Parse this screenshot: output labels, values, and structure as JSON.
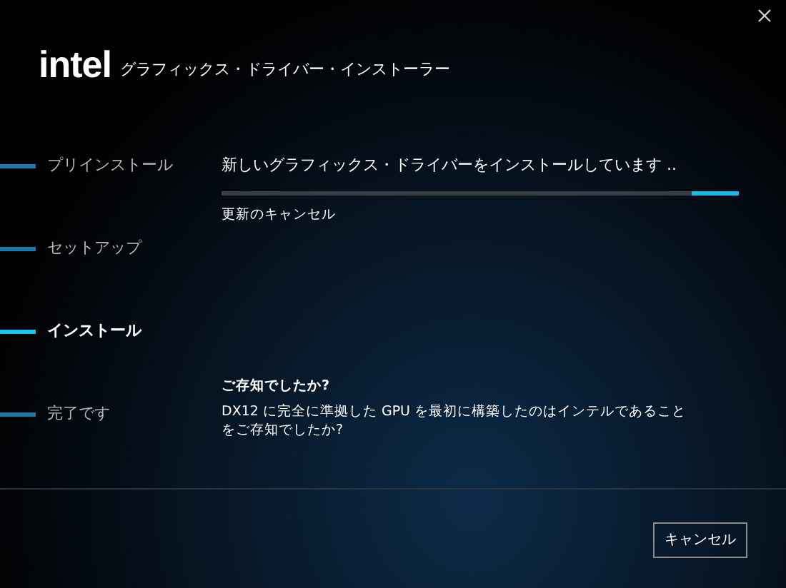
{
  "header": {
    "logo": "intel",
    "title": "グラフィックス・ドライバー・インストーラー"
  },
  "steps": [
    {
      "label": "プリインストール",
      "selected": false
    },
    {
      "label": "セットアップ",
      "selected": false
    },
    {
      "label": "インストール",
      "selected": true
    },
    {
      "label": "完了です",
      "selected": false
    }
  ],
  "status": {
    "message": "新しいグラフィックス・ドライバーをインストールしています ..",
    "cancel_link": "更新のキャンセル",
    "progress": {
      "level": 0.09
    }
  },
  "tip": {
    "title": "ご存知でしたか?",
    "text": "DX12 に完全に準拠した GPU を最初に構築したのはインテルであることをご存知でしたか?"
  },
  "buttons": [
    {
      "label": "キャンセル"
    }
  ]
}
